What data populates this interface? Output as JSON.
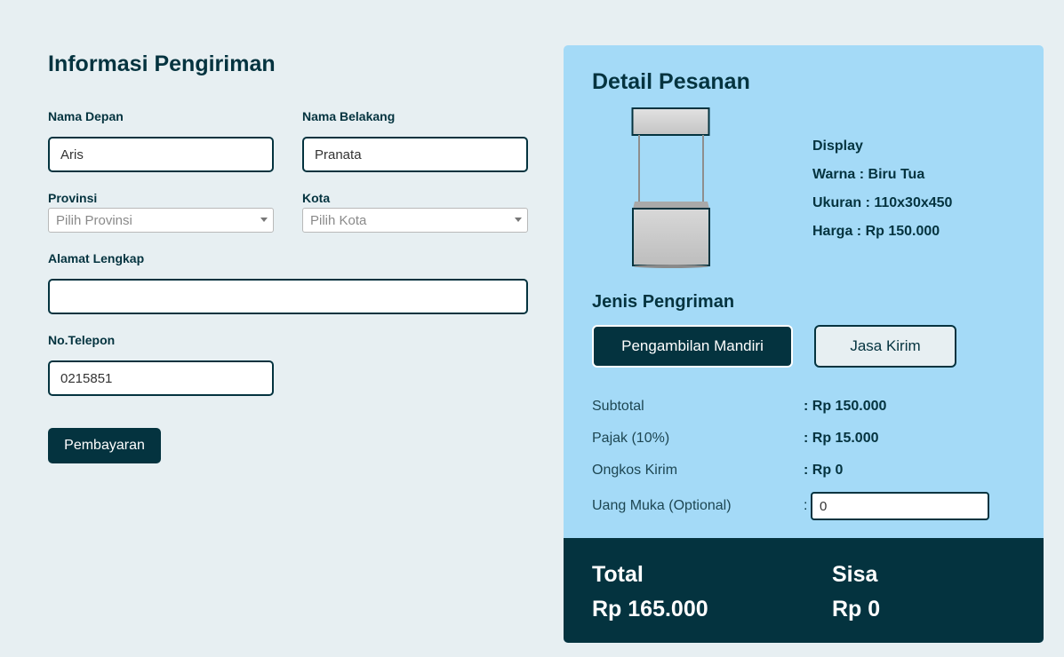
{
  "shipping_form": {
    "title": "Informasi Pengiriman",
    "first_name_label": "Nama Depan",
    "first_name_value": "Aris",
    "last_name_label": "Nama Belakang",
    "last_name_value": "Pranata",
    "province_label": "Provinsi",
    "province_placeholder": "Pilih Provinsi",
    "city_label": "Kota",
    "city_placeholder": "Pilih Kota",
    "address_label": "Alamat Lengkap",
    "address_value": "",
    "phone_label": "No.Telepon",
    "phone_value": "0215851",
    "submit_label": "Pembayaran"
  },
  "order": {
    "title": "Detail Pesanan",
    "product_name": "Display",
    "color_line": "Warna : Biru Tua",
    "size_line": "Ukuran : 110x30x450",
    "price_line": "Harga : Rp 150.000",
    "shipping_title": "Jenis Pengriman",
    "shipping_options": [
      {
        "label": "Pengambilan Mandiri",
        "selected": true
      },
      {
        "label": "Jasa Kirim",
        "selected": false
      }
    ],
    "summary": {
      "subtotal_label": "Subtotal",
      "subtotal_value": ": Rp 150.000",
      "tax_label": "Pajak (10%)",
      "tax_value": ": Rp 15.000",
      "shipping_cost_label": "Ongkos Kirim",
      "shipping_cost_value": ": Rp 0",
      "down_payment_label": "Uang Muka (Optional)",
      "down_payment_colon": ":",
      "down_payment_value": "0"
    },
    "total_label": "Total",
    "total_value": "Rp 165.000",
    "remaining_label": "Sisa",
    "remaining_value": "Rp 0"
  },
  "colors": {
    "primary": "#04333f",
    "panel": "#a4daf7",
    "background": "#e7eff2"
  }
}
